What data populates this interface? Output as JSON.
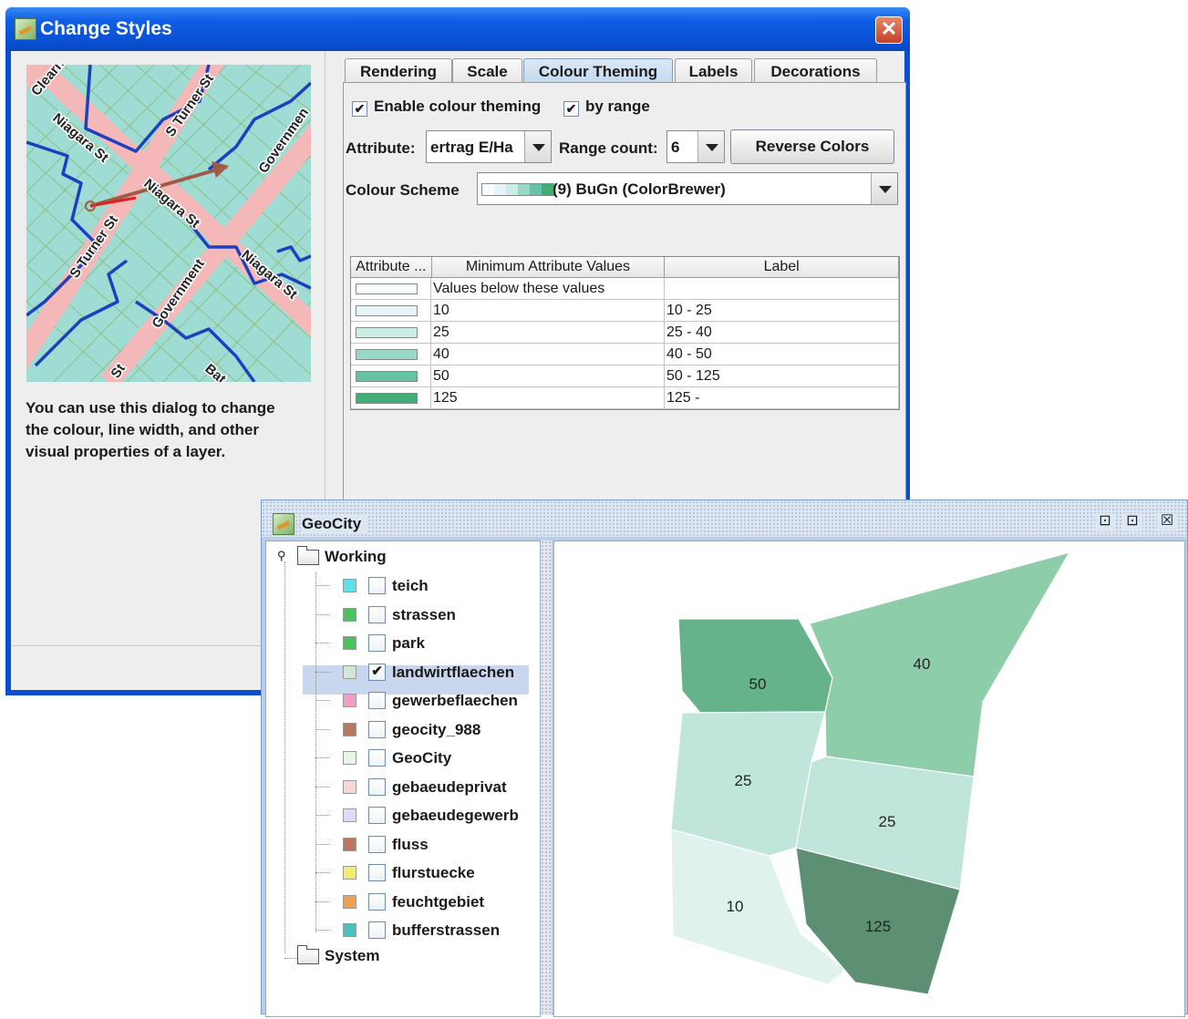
{
  "change_styles": {
    "title": "Change Styles",
    "close_glyph": "✕",
    "description": "You can use this dialog to change the colour, line width, and other visual properties of a layer.",
    "map_street_labels": [
      "Clearn",
      "S Turner St",
      "Niagara St",
      "Governmen",
      "Niagara St",
      "S Turner St",
      "Government",
      "Niagara St",
      "Bat",
      "St"
    ],
    "tabs": [
      "Rendering",
      "Scale",
      "Colour Theming",
      "Labels",
      "Decorations"
    ],
    "active_tab": "Colour Theming",
    "enable_colour_theming": {
      "label": "Enable colour theming",
      "checked": true
    },
    "by_range": {
      "label": "by range",
      "checked": true
    },
    "attribute": {
      "label": "Attribute:",
      "value": "ertrag E/Ha"
    },
    "range_count": {
      "label": "Range count:",
      "value": "6"
    },
    "reverse_colors_label": "Reverse Colors",
    "colour_scheme": {
      "label": "Colour Scheme",
      "value": "(9) BuGn (ColorBrewer)"
    },
    "table": {
      "headers": [
        "Attribute ...",
        "Minimum Attribute Values",
        "Label"
      ],
      "rows": [
        {
          "color": "#f7fcfd",
          "min": "Values below these values",
          "label": ""
        },
        {
          "color": "#e5f5f9",
          "min": "10",
          "label": "10 - 25"
        },
        {
          "color": "#ccece6",
          "min": "25",
          "label": "25 - 40"
        },
        {
          "color": "#99d8c9",
          "min": "40",
          "label": "40 - 50"
        },
        {
          "color": "#66c2a4",
          "min": "50",
          "label": "50 - 125"
        },
        {
          "color": "#41ae76",
          "min": "125",
          "label": "125 -"
        }
      ]
    }
  },
  "geocity": {
    "title": "GeoCity",
    "controls": [
      "⊡",
      "⊡",
      "☒"
    ],
    "tree": {
      "working": "Working",
      "system": "System",
      "layers": [
        {
          "name": "teich",
          "color": "#5fe0e8",
          "checked": false
        },
        {
          "name": "strassen",
          "color": "#4cc25c",
          "checked": false
        },
        {
          "name": "park",
          "color": "#4cc25c",
          "checked": false
        },
        {
          "name": "landwirtflaechen",
          "color": "#d0e8d8",
          "checked": true,
          "selected": true
        },
        {
          "name": "gewerbeflaechen",
          "color": "#f0a0c8",
          "checked": false
        },
        {
          "name": "geocity_988",
          "color": "#b87860",
          "checked": false
        },
        {
          "name": "GeoCity",
          "color": "#e6f7e6",
          "checked": false
        },
        {
          "name": "gebaeudeprivat",
          "color": "#f8d8d0",
          "checked": false
        },
        {
          "name": "gebaeudegewerb",
          "color": "#dcdcf4",
          "checked": false
        },
        {
          "name": "fluss",
          "color": "#b87860",
          "checked": false
        },
        {
          "name": "flurstuecke",
          "color": "#f4ec70",
          "checked": false
        },
        {
          "name": "feuchtgebiet",
          "color": "#f0a050",
          "checked": false
        },
        {
          "name": "bufferstrassen",
          "color": "#4cc0c0",
          "checked": false
        }
      ]
    },
    "map_parcels": [
      {
        "label": "50",
        "color": "#66b38b"
      },
      {
        "label": "40",
        "color": "#8dcdaa"
      },
      {
        "label": "25",
        "color": "#c0e5da"
      },
      {
        "label": "25",
        "color": "#c0e5da"
      },
      {
        "label": "10",
        "color": "#dff2ee"
      },
      {
        "label": "125",
        "color": "#5d9073"
      }
    ]
  }
}
